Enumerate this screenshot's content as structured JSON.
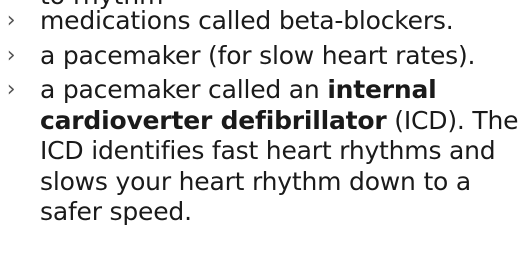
{
  "document": {
    "partial_top_line": "to rhythm",
    "bullet_symbol": "›",
    "items": [
      {
        "text": "medications called beta-blockers."
      },
      {
        "text": "a pacemaker (for slow heart rates)."
      },
      {
        "prefix": "a pacemaker called an ",
        "bold": "internal cardioverter defibrillator",
        "suffix": " (ICD). The ICD identifies fast heart rhythms and slows your heart rhythm down to a safer speed."
      }
    ]
  }
}
